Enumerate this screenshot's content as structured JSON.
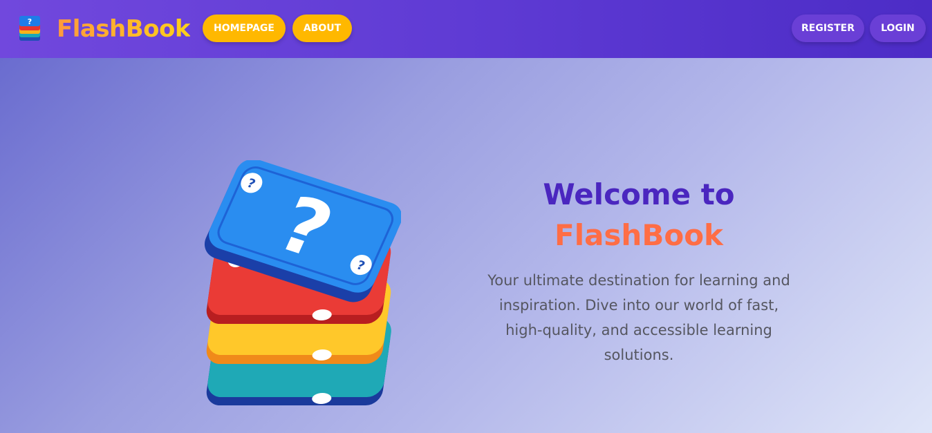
{
  "navbar": {
    "brand_name": "FlashBook",
    "brand_icon": "stacked-cards-icon",
    "links": {
      "homepage": "HOMEPAGE",
      "about": "ABOUT"
    },
    "auth": {
      "register": "REGISTER",
      "login": "LOGIN"
    },
    "colors": {
      "bar": "#5f3bd4",
      "nav_button": "#ffb800",
      "auth_button": "#6a3fd6"
    }
  },
  "hero": {
    "heading_line1": "Welcome to",
    "heading_line2": "FlashBook",
    "tagline": "Your ultimate destination for learning and inspiration. Dive into our world of fast, high-quality, and accessible learning solutions.",
    "illustration": "flashcard-stack-question-mark-icon",
    "colors": {
      "heading": "#4a26bf",
      "brand": "#ff6d45",
      "tagline": "#555660"
    }
  }
}
